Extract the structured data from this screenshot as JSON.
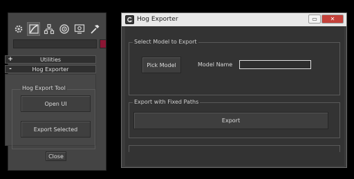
{
  "command_panel": {
    "tabs": [
      "gear-icon",
      "modify-icon",
      "hierarchy-icon",
      "motion-icon",
      "display-icon",
      "utilities-icon"
    ],
    "name_value": "",
    "swatch_color": "#8a1634",
    "rollouts": [
      {
        "sign": "+",
        "title": "Utilities"
      },
      {
        "sign": "-",
        "title": "Hog Exporter"
      }
    ],
    "group_title": "Hog Export Tool",
    "open_ui_label": "Open UI",
    "export_selected_label": "Export Selected",
    "close_label": "Close"
  },
  "window": {
    "title": "Hog Exporter",
    "close_symbol": "✕",
    "min_symbol": "▭",
    "select_group_title": "Select Model to Export",
    "pick_model_label": "Pick Model",
    "model_name_label": "Model Name",
    "model_name_value": "",
    "fixed_paths_group_title": "Export with Fixed Paths",
    "export_label": "Export"
  }
}
